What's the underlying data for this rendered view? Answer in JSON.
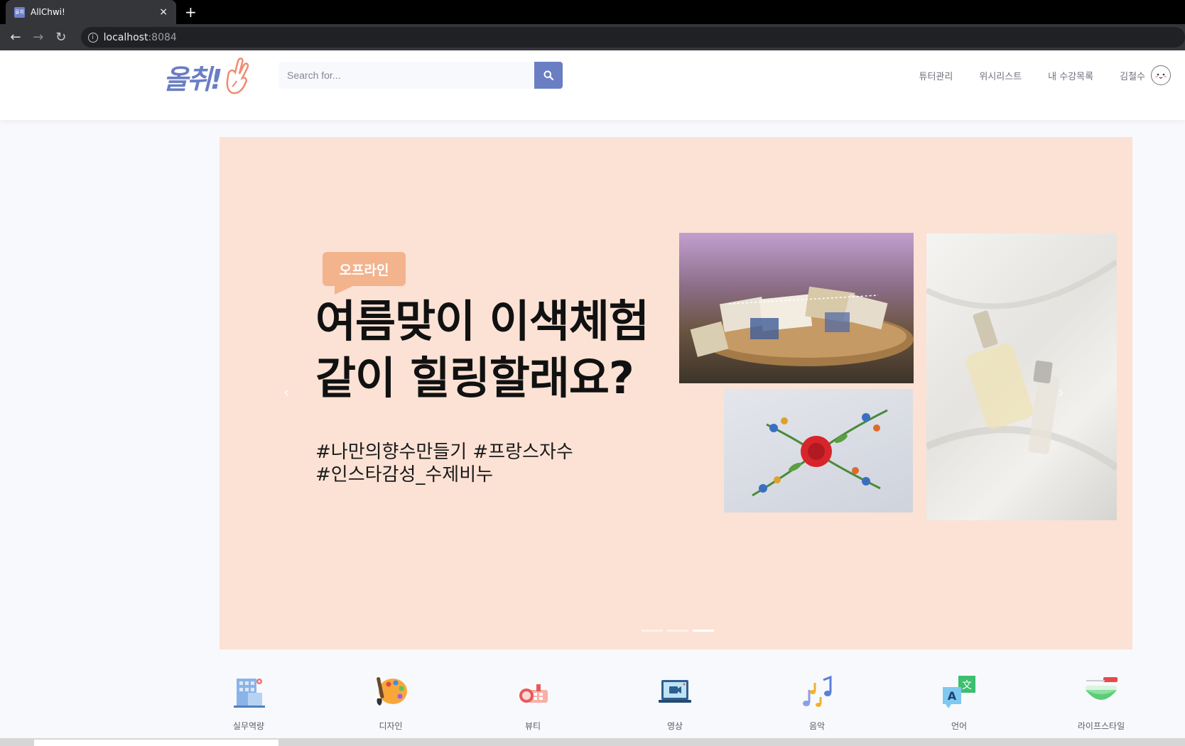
{
  "browser": {
    "tab_title": "AllChwi!",
    "favicon_text": "올취",
    "close_glyph": "×",
    "new_tab_glyph": "+",
    "url_host": "localhost",
    "url_port": ":8084"
  },
  "header": {
    "logo_text": "올취!",
    "search_placeholder": "Search for...",
    "menu": [
      "튜터관리",
      "위시리스트",
      "내 수강목록"
    ],
    "user_name": "김철수"
  },
  "carousel": {
    "badge": "오프라인",
    "headline_line1": "여름맞이 이색체험",
    "headline_line2": "같이 힐링할래요?",
    "hashtag_line1": "#나만의향수만들기 #프랑스자수",
    "hashtag_line2": "#인스타감성_수제비누",
    "prev_glyph": "‹",
    "next_glyph": "›",
    "active_indicator": 3,
    "indicator_count": 3,
    "bg_color": "#fbe2d5"
  },
  "categories": [
    {
      "label": "실무역량",
      "icon": "office-building-icon"
    },
    {
      "label": "디자인",
      "icon": "paint-palette-icon"
    },
    {
      "label": "뷰티",
      "icon": "makeup-kit-icon"
    },
    {
      "label": "영상",
      "icon": "video-laptop-icon"
    },
    {
      "label": "음악",
      "icon": "music-notes-icon"
    },
    {
      "label": "언어",
      "icon": "translate-icon"
    },
    {
      "label": "라이프스타일",
      "icon": "salad-bowl-icon"
    }
  ],
  "colors": {
    "brand": "#6a7ec4",
    "badge": "#f2b38d"
  }
}
